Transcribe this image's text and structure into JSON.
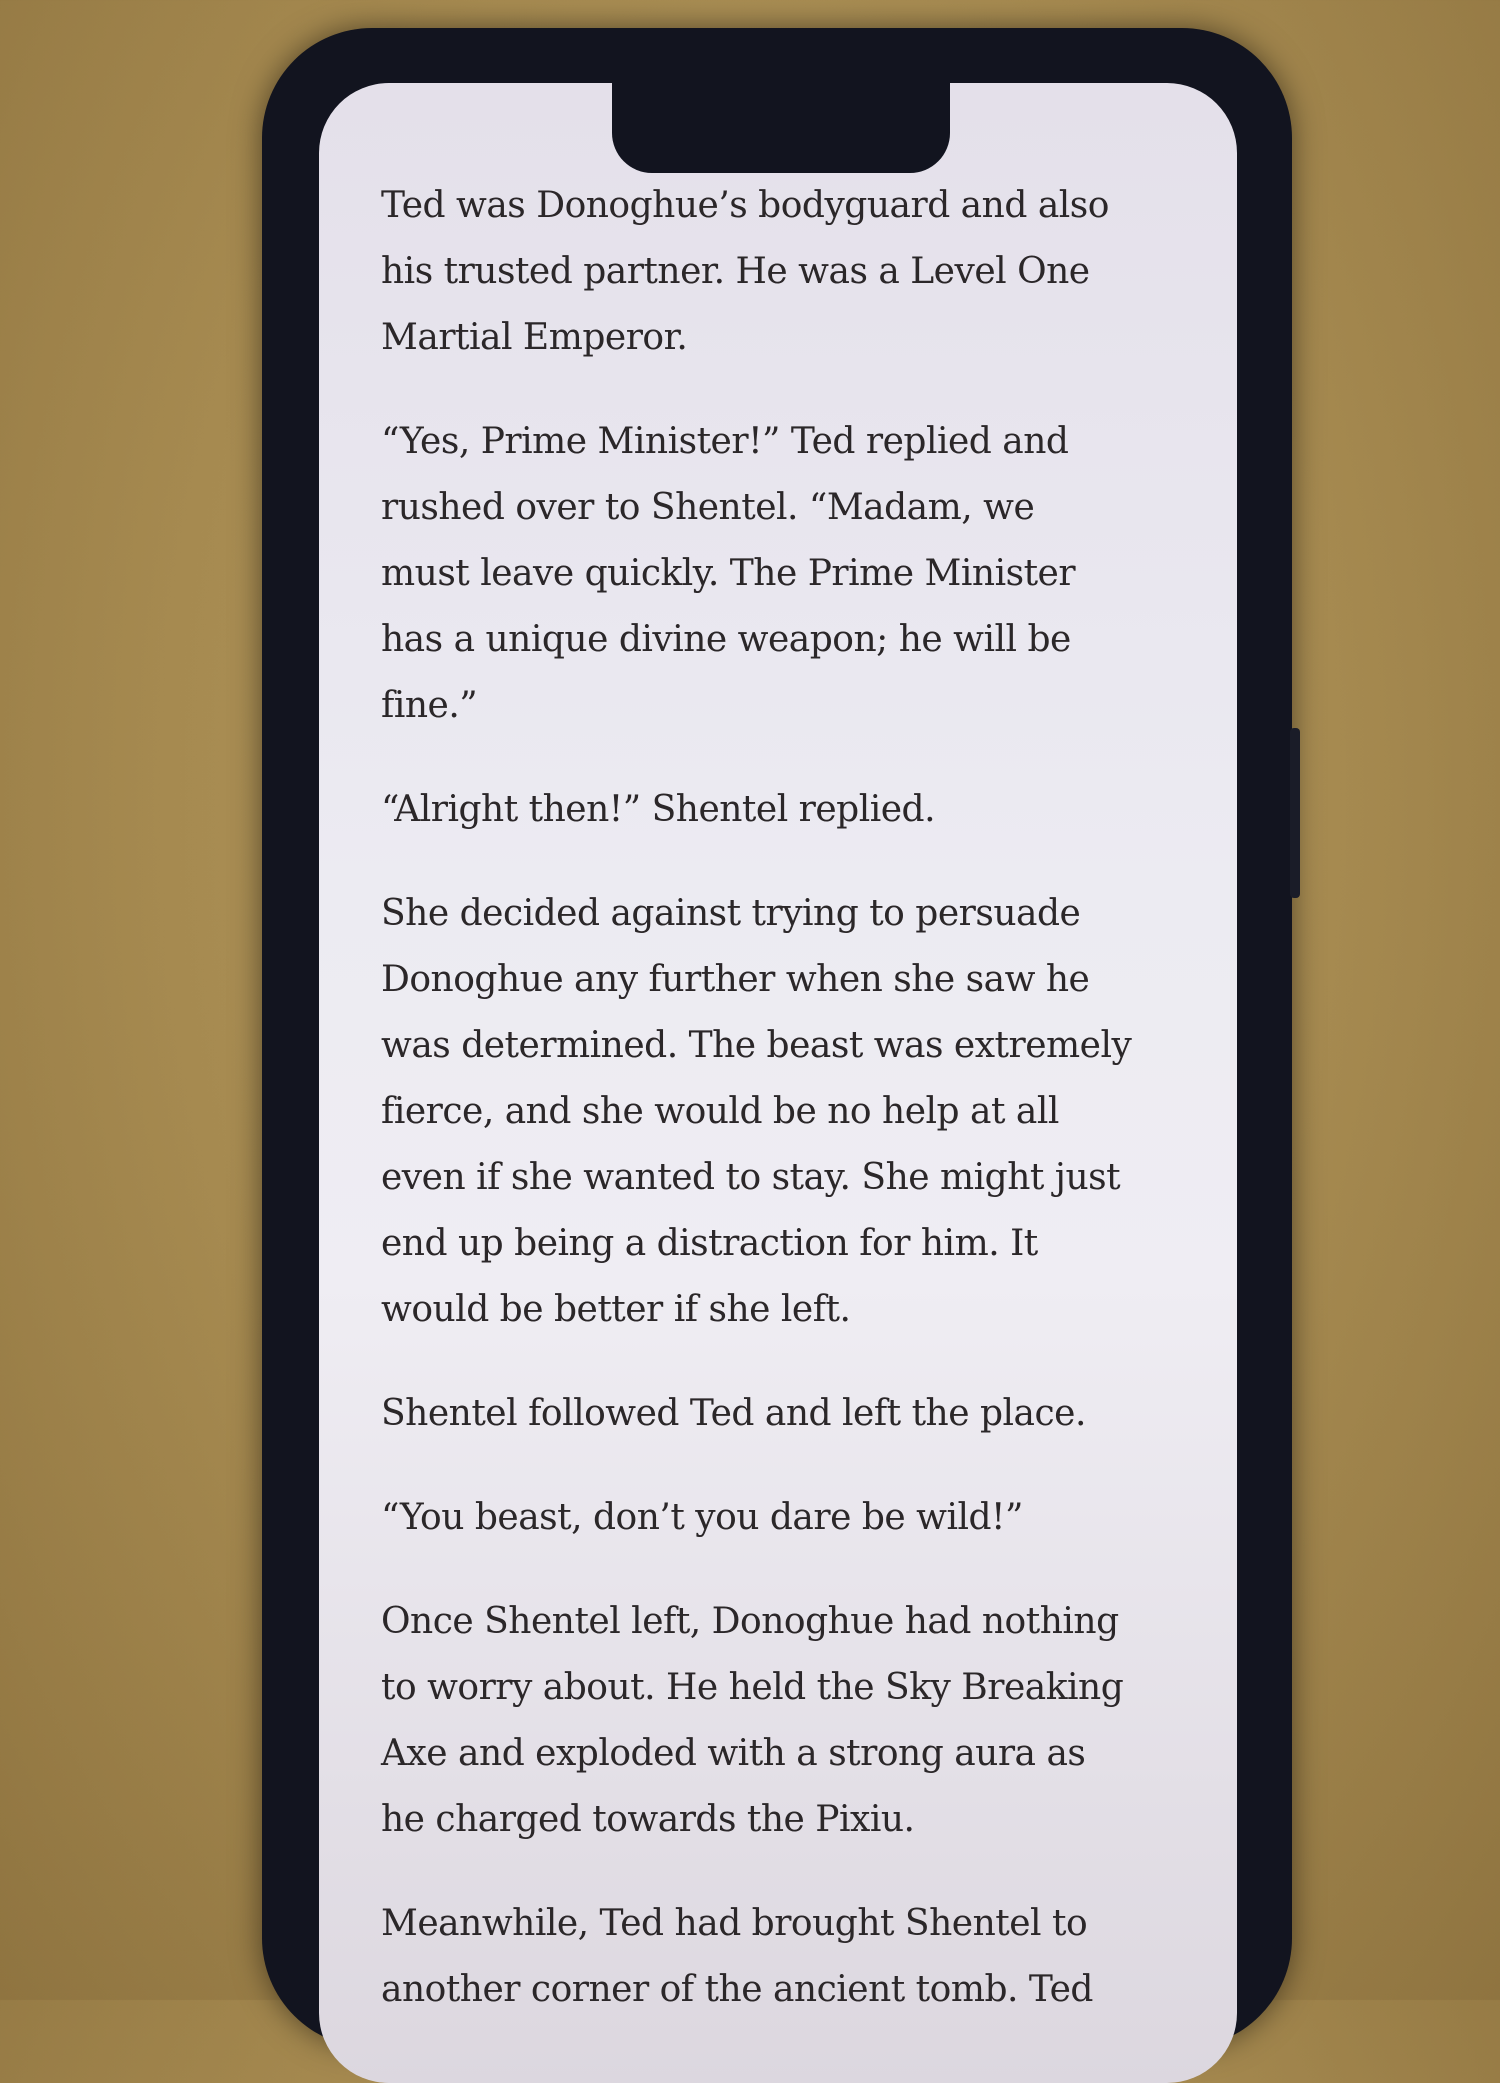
{
  "reader": {
    "paragraphs": [
      {
        "lines": [
          "Ted was Donoghue’s bodyguard and also",
          "his trusted partner. He was a Level One",
          "Martial Emperor."
        ]
      },
      {
        "lines": [
          "“Yes, Prime Minister!” Ted replied and",
          "rushed over to Shentel. “Madam, we",
          "must leave quickly. The Prime Minister",
          "has a unique divine weapon; he will be",
          "fine.”"
        ]
      },
      {
        "lines": [
          "“Alright then!” Shentel replied."
        ]
      },
      {
        "lines": [
          "She decided against trying to persuade",
          "Donoghue any further when she saw he",
          "was determined. The beast was extremely",
          "fierce, and she would be no help at all",
          "even if she wanted to stay. She might just",
          "end up being a distraction for him. It",
          "would be better if she left."
        ]
      },
      {
        "lines": [
          "Shentel followed Ted and left the place."
        ]
      },
      {
        "lines": [
          "“You beast, don’t you dare be wild!”"
        ]
      },
      {
        "lines": [
          "Once Shentel left, Donoghue had nothing",
          "to worry about. He held the Sky Breaking",
          "Axe and exploded with a strong aura as",
          "he charged towards the Pixiu."
        ]
      },
      {
        "lines": [
          "Meanwhile, Ted had brought Shentel to",
          "another corner of the ancient tomb. Ted"
        ]
      }
    ]
  }
}
